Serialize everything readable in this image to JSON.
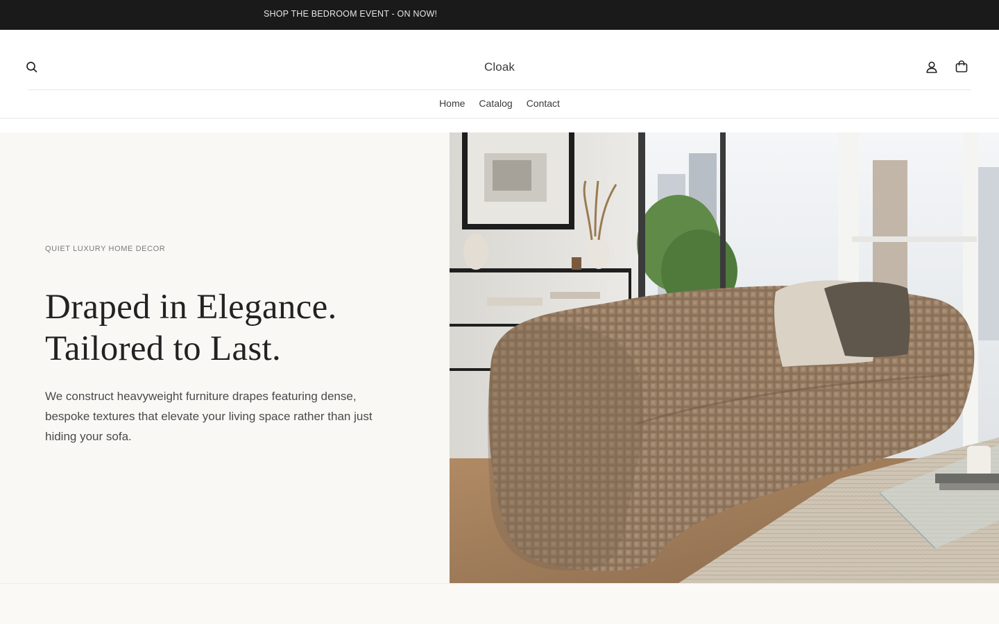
{
  "announcement": {
    "text": "SHOP THE BEDROOM EVENT - ON NOW!"
  },
  "header": {
    "logo": "Cloak",
    "icons": {
      "search": "search-icon",
      "account": "user-icon",
      "cart": "shopping-bag-icon"
    },
    "nav": [
      {
        "label": "Home"
      },
      {
        "label": "Catalog"
      },
      {
        "label": "Contact"
      }
    ]
  },
  "hero": {
    "eyebrow": "QUIET LUXURY HOME DECOR",
    "headline_line1": "Draped in Elegance.",
    "headline_line2": "Tailored to Last.",
    "subtext": "We construct heavyweight furniture drapes featuring dense, bespoke textures that elevate your living space rather than just hiding your sofa."
  },
  "colors": {
    "announcement_bg": "#1a1a1a",
    "hero_bg": "#f9f8f5",
    "sofa": "#8a7058",
    "text_dark": "#222222"
  }
}
